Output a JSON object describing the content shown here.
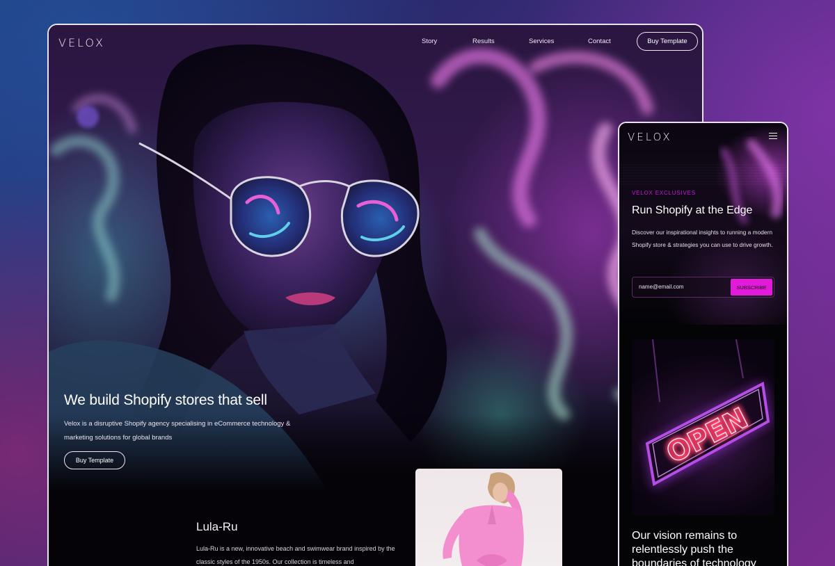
{
  "desktop": {
    "logo": "VELOX",
    "nav": [
      "Story",
      "Results",
      "Services",
      "Contact"
    ],
    "buy_button": "Buy Template",
    "hero": {
      "headline": "We build Shopify stores that sell",
      "description": "Velox is a disruptive Shopify agency specialising in eCommerce technology & marketing solutions for global brands",
      "cta": "Buy Template"
    },
    "feature": {
      "title": "Lula-Ru",
      "description": "Lula-Ru is a new, innovative beach and swimwear brand inspired by the classic styles of the 1950s. Our collection is timeless and"
    }
  },
  "mobile": {
    "logo": "VELOX",
    "eyebrow": "VELOX EXCLUSIVES",
    "title": "Run Shopify at the Edge",
    "description": "Discover our inspirational insights to running a modern Shopify store & strategies you can use to drive growth.",
    "email_placeholder": "name@email.com",
    "subscribe": "SUBSCRIBE",
    "sign_text": "OPEN",
    "vision": "Our vision remains to relentlessly push the boundaries of technology"
  },
  "colors": {
    "accent_magenta": "#e21ad9",
    "eyebrow": "#c21bd8",
    "frame_border": "#e9e4f2"
  }
}
